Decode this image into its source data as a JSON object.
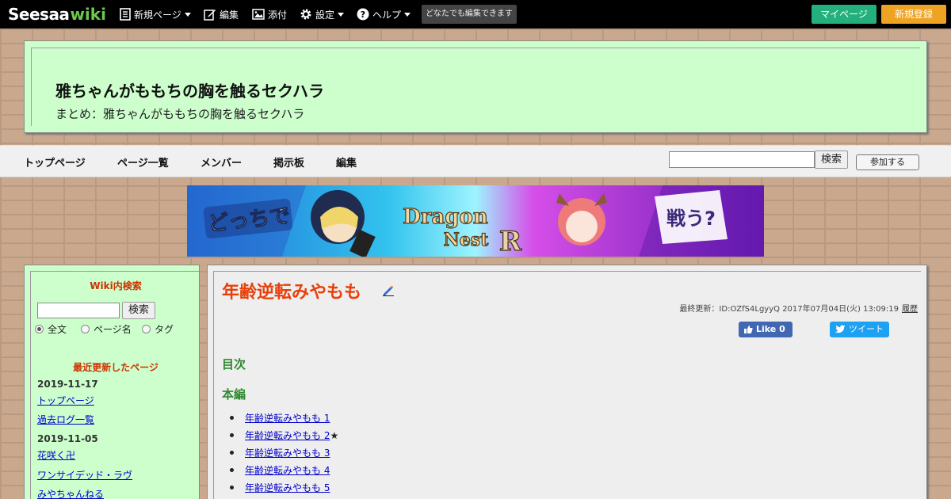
{
  "topbar": {
    "logo_seesaa": "Seesaa",
    "logo_wiki": "wiki",
    "menu": [
      {
        "label": "新規ページ",
        "icon": "document-icon"
      },
      {
        "label": "編集",
        "icon": "edit-icon"
      },
      {
        "label": "添付",
        "icon": "image-icon"
      },
      {
        "label": "設定",
        "icon": "gear-icon"
      },
      {
        "label": "ヘルプ",
        "icon": "help-icon"
      }
    ],
    "anyone_edit": "どなたでも編集できます",
    "mypage": "マイページ",
    "signup": "新規登録",
    "colors": {
      "mypage": "#24b07c",
      "signup": "#efa322"
    }
  },
  "header": {
    "title": "雅ちゃんがももちの胸を触るセクハラ",
    "description": "まとめ：雅ちゃんがももちの胸を触るセクハラ"
  },
  "gnav": {
    "links": [
      "トップページ",
      "ページ一覧",
      "メンバー",
      "掲示板",
      "編集"
    ],
    "search_button": "検索",
    "join_button": "参加する"
  },
  "banner": {
    "text_left": "どっちで",
    "logo_line1": "Dragon",
    "logo_line2": "Nest",
    "logo_r": "R",
    "text_right": "戦う?"
  },
  "sidebar": {
    "search_heading": "Wiki内検索",
    "search_button": "検索",
    "radio_options": [
      "全文",
      "ページ名",
      "タグ"
    ],
    "radio_selected": "全文",
    "recent_heading": "最近更新したページ",
    "groups": [
      {
        "date": "2019-11-17",
        "pages": [
          "トップページ",
          "過去ログ一覧"
        ]
      },
      {
        "date": "2019-11-05",
        "pages": [
          "花咲く卍",
          "ワンサイデッド・ラヴ",
          "みやちゃんねる"
        ]
      }
    ]
  },
  "main": {
    "page_title": "年齢逆転みやもも",
    "last_update": "最終更新：ID:OZfS4LgyyQ 2017年07月04日(火) 13:09:19",
    "history": "履歴",
    "fb_like": "Like 0",
    "tweet": "ツイート",
    "toc_heading": "目次",
    "section_heading": "本編",
    "items": [
      {
        "label": "年齢逆転みやもも 1",
        "star": ""
      },
      {
        "label": "年齢逆転みやもも 2",
        "star": "★"
      },
      {
        "label": "年齢逆転みやもも 3",
        "star": ""
      },
      {
        "label": "年齢逆転みやもも 4",
        "star": ""
      },
      {
        "label": "年齢逆転みやもも 5",
        "star": ""
      }
    ]
  }
}
